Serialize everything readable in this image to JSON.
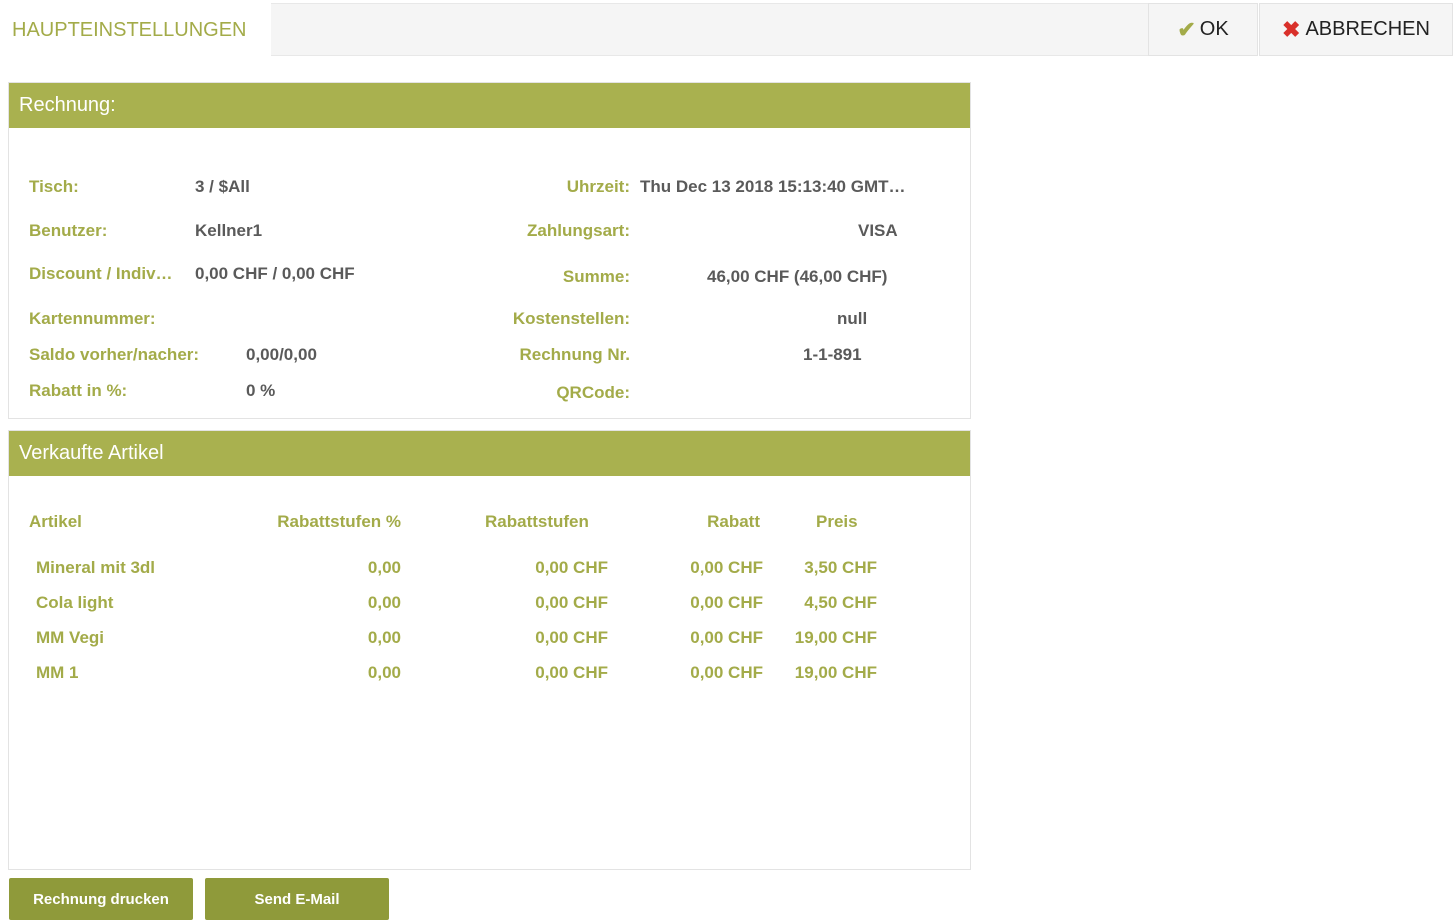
{
  "header": {
    "title": "HAUPTEINSTELLUNGEN",
    "ok_label": "OK",
    "cancel_label": "ABBRECHEN"
  },
  "invoice": {
    "heading": "Rechnung:",
    "left": [
      {
        "label": "Tisch:",
        "value": "3 / $All"
      },
      {
        "label": "Benutzer:",
        "value": "Kellner1"
      },
      {
        "label": "Discount / Indiv…",
        "value": "0,00 CHF / 0,00 CHF"
      },
      {
        "label": "Kartennummer:",
        "value": ""
      },
      {
        "label": "Saldo vorher/nacher:",
        "value": "0,00/0,00"
      },
      {
        "label": "Rabatt in %:",
        "value": "0 %"
      }
    ],
    "right": [
      {
        "label": "Uhrzeit:",
        "value": "Thu Dec 13 2018 15:13:40 GMT…"
      },
      {
        "label": "Zahlungsart:",
        "value": "VISA"
      },
      {
        "label": "Summe:",
        "value": "46,00 CHF (46,00 CHF)"
      },
      {
        "label": "Kostenstellen:",
        "value": "null"
      },
      {
        "label": "Rechnung Nr.",
        "value": "1-1-891"
      },
      {
        "label": "QRCode:",
        "value": ""
      }
    ]
  },
  "items": {
    "heading": "Verkaufte Artikel",
    "columns": [
      "Artikel",
      "Rabattstufen %",
      "Rabattstufen",
      "Rabatt",
      "Preis"
    ],
    "rows": [
      [
        "Mineral mit 3dl",
        "0,00",
        "0,00 CHF",
        "0,00 CHF",
        "3,50 CHF"
      ],
      [
        "Cola light",
        "0,00",
        "0,00 CHF",
        "0,00 CHF",
        "4,50 CHF"
      ],
      [
        "MM Vegi",
        "0,00",
        "0,00 CHF",
        "0,00 CHF",
        "19,00 CHF"
      ],
      [
        "MM 1",
        "0,00",
        "0,00 CHF",
        "0,00 CHF",
        "19,00 CHF"
      ]
    ]
  },
  "actions": {
    "print_label": "Rechnung drucken",
    "mail_label": "Send E-Mail"
  },
  "icons": {
    "ok": "checkmark-icon",
    "cancel": "x-icon"
  },
  "colors": {
    "accent": "#a9b14f",
    "label": "#a3ab49",
    "button": "#8f9a3a",
    "cancel_icon": "#d9302a"
  }
}
